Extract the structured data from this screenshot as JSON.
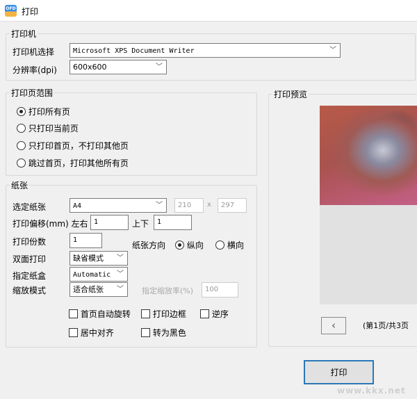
{
  "window": {
    "title": "打印",
    "app_icon_text": "OFD"
  },
  "printer": {
    "group_label": "打印机",
    "select_label": "打印机选择",
    "printer_value": "Microsoft XPS Document Writer",
    "dpi_label": "分辨率(dpi)",
    "dpi_value": "600x600"
  },
  "range": {
    "group_label": "打印页范围",
    "options": [
      {
        "label": "打印所有页",
        "checked": true
      },
      {
        "label": "只打印当前页",
        "checked": false
      },
      {
        "label": "只打印首页，不打印其他页",
        "checked": false
      },
      {
        "label": "跳过首页，打印其他所有页",
        "checked": false
      }
    ]
  },
  "paper": {
    "group_label": "纸张",
    "size_label": "选定纸张",
    "size_value": "A4",
    "width": "210",
    "x_sep": "x",
    "height": "297",
    "offset_label": "打印偏移(mm) 左右",
    "offset_lr": "1",
    "offset_ud_label": "上下",
    "offset_ud": "1",
    "copies_label": "打印份数",
    "copies": "1",
    "orientation_label": "纸张方向",
    "portrait": "纵向",
    "landscape": "横向",
    "orientation": "portrait",
    "duplex_label": "双面打印",
    "duplex_value": "缺省模式",
    "tray_label": "指定纸盒",
    "tray_value": "Automatic",
    "scale_mode_label": "缩放模式",
    "scale_mode_value": "适合纸张",
    "scale_rate_label": "指定缩放率(%)",
    "scale_rate": "100",
    "checkboxes": [
      {
        "label": "首页自动旋转",
        "checked": false
      },
      {
        "label": "打印边框",
        "checked": false
      },
      {
        "label": "逆序",
        "checked": false
      },
      {
        "label": "居中对齐",
        "checked": false
      },
      {
        "label": "转为黑色",
        "checked": false
      }
    ]
  },
  "preview": {
    "group_label": "打印预览",
    "page_info": "(第1页/共3页"
  },
  "actions": {
    "print": "打印"
  },
  "watermark": "www.kkx.net"
}
